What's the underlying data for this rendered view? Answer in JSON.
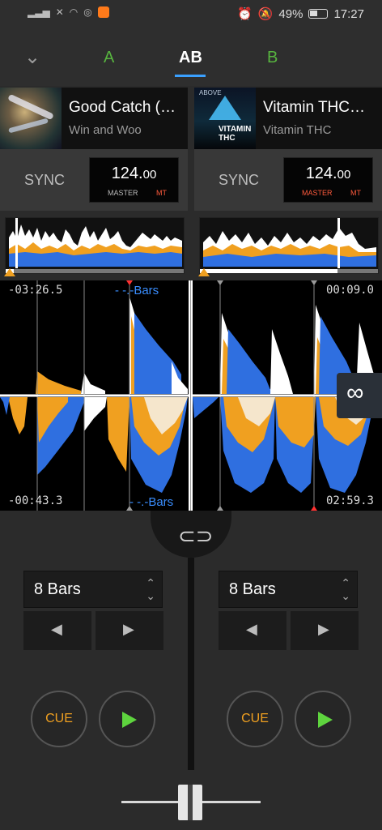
{
  "status_bar": {
    "battery": "49%",
    "time": "17:27"
  },
  "tabs": {
    "collapse_icon": "chevron-down-icon",
    "a": "A",
    "ab": "AB",
    "b": "B",
    "active": "AB"
  },
  "deck_a": {
    "title": "Good Catch (…",
    "artist": "Win and Woo",
    "sync": "SYNC",
    "bpm_int": "124.",
    "bpm_dec": "00",
    "master": "MASTER",
    "mt": "MT",
    "elapsed": "-03:26.5",
    "remaining": "-00:43.3",
    "bars": "- -.-Bars",
    "loop": "8 Bars",
    "cue": "CUE"
  },
  "deck_b": {
    "title": "Vitamin THC…",
    "artist": "Vitamin THC",
    "sync": "SYNC",
    "bpm_int": "124.",
    "bpm_dec": "00",
    "master": "MASTER",
    "mt": "MT",
    "elapsed": "00:09.0",
    "remaining": "02:59.3",
    "bars": "- -.-Bars",
    "loop": "8 Bars",
    "cue": "CUE",
    "cover_top": "ABOVE",
    "cover_text": "VITAMIN THC"
  },
  "colors": {
    "accent_blue": "#3a8eff",
    "green": "#57b43f",
    "orange": "#f0a020",
    "red": "#ff5a3c"
  }
}
